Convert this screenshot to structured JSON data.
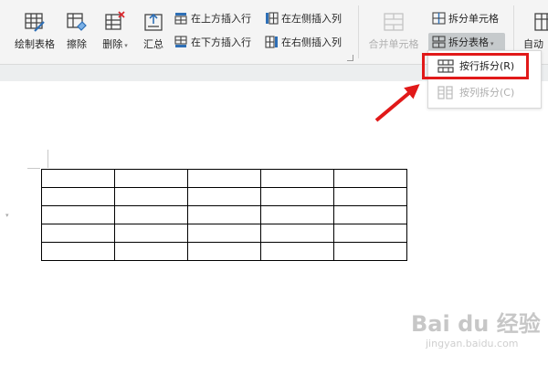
{
  "ribbon": {
    "draw_table": "绘制表格",
    "erase": "擦除",
    "delete": "删除",
    "summary": "汇总",
    "insert_above": "在上方插入行",
    "insert_below": "在下方插入行",
    "insert_left": "在左侧插入列",
    "insert_right": "在右侧插入列",
    "merge_cells": "合并单元格",
    "split_cells": "拆分单元格",
    "split_table": "拆分表格",
    "auto_partial": "自动"
  },
  "split_menu": {
    "by_row": "按行拆分(R)",
    "by_column": "按列拆分(C)"
  },
  "table": {
    "rows": 5,
    "columns": 5
  },
  "watermark": {
    "brand": "Bai du 经验",
    "url": "jingyan.baidu.com"
  },
  "colors": {
    "highlight_red": "#e11919",
    "ribbon_bg": "#f4f4f4",
    "icon_blue": "#2e6fb6"
  }
}
